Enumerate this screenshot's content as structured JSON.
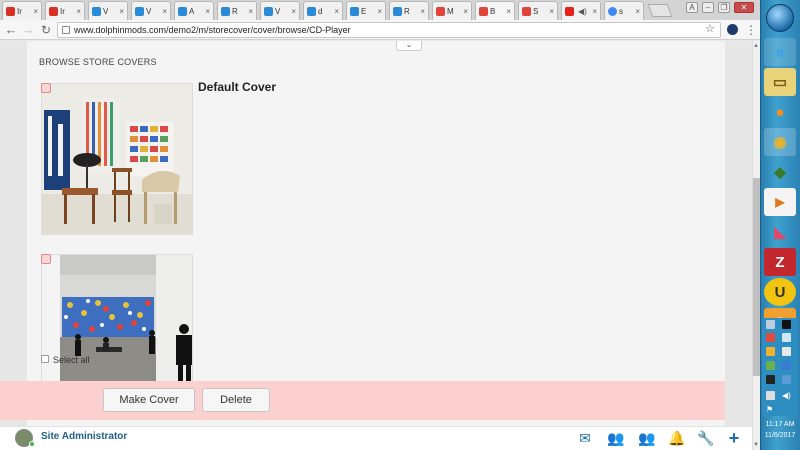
{
  "browser": {
    "tabs": [
      {
        "label": "Ir",
        "color": "#d93025"
      },
      {
        "label": "Ir",
        "color": "#d93025"
      },
      {
        "label": "V",
        "color": "#2b8ad6"
      },
      {
        "label": "V",
        "color": "#2b8ad6"
      },
      {
        "label": "A",
        "color": "#2b8ad6"
      },
      {
        "label": "R",
        "color": "#2b8ad6"
      },
      {
        "label": "V",
        "color": "#2b8ad6"
      },
      {
        "label": "d",
        "color": "#2b8ad6"
      },
      {
        "label": "E",
        "color": "#2b8ad6"
      },
      {
        "label": "R",
        "color": "#2b8ad6"
      },
      {
        "label": "M",
        "color": "#e0443a"
      },
      {
        "label": "B",
        "color": "#e0443a"
      },
      {
        "label": "S",
        "color": "#e0443a"
      },
      {
        "label": "",
        "color": "#e62117"
      },
      {
        "label": "s",
        "color": "#4285f4"
      }
    ],
    "url": "www.dolphinmods.com/demo2/m/storecover/cover/browse/CD-Player"
  },
  "page": {
    "heading": "BROWSE STORE COVERS",
    "covers": [
      {
        "label": "Default Cover"
      },
      {
        "label": ""
      }
    ]
  },
  "actions": {
    "select_all": "Select all",
    "make_cover": "Make Cover",
    "delete": "Delete"
  },
  "footer": {
    "user": "Site Administrator"
  },
  "taskbar": {
    "time": "11:17 AM",
    "date": "11/6/2017"
  },
  "colors": {
    "accent": "#1a6fb3",
    "action_bar": "#fdd0d0"
  }
}
